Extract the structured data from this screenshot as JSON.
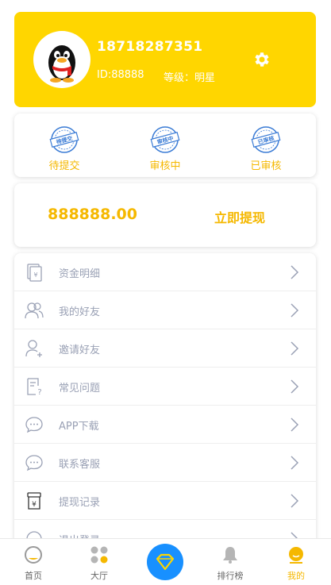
{
  "profile": {
    "phone": "18718287351",
    "id_text": "ID:88888",
    "level_text": "等级：明星",
    "avatar_icon": "qq-penguin-avatar",
    "settings_icon": "gear-icon"
  },
  "status": {
    "items": [
      {
        "label": "待提交",
        "stamp": "待提交"
      },
      {
        "label": "审核中",
        "stamp": "审核中"
      },
      {
        "label": "已审核",
        "stamp": "已审核"
      }
    ]
  },
  "wallet": {
    "balance": "888888.00",
    "withdraw_label": "立即提现"
  },
  "menu": {
    "items": [
      {
        "label": "资金明细",
        "icon": "ledger-icon"
      },
      {
        "label": "我的好友",
        "icon": "friends-icon"
      },
      {
        "label": "邀请好友",
        "icon": "invite-user-icon"
      },
      {
        "label": "常见问题",
        "icon": "faq-icon"
      },
      {
        "label": "APP下载",
        "icon": "chat-bubble-icon"
      },
      {
        "label": "联系客服",
        "icon": "chat-bubble-icon"
      },
      {
        "label": "提现记录",
        "icon": "withdraw-record-icon"
      },
      {
        "label": "退出登录",
        "icon": "logout-icon"
      }
    ]
  },
  "tabbar": {
    "items": [
      {
        "label": "首页",
        "icon": "home-icon"
      },
      {
        "label": "大厅",
        "icon": "hall-icon"
      },
      {
        "label": "排行榜",
        "icon": "bell-icon"
      },
      {
        "label": "我的",
        "icon": "profile-icon"
      }
    ],
    "center_icon": "diamond-icon"
  },
  "colors": {
    "brand_yellow": "#FFD600",
    "accent_text": "#F5B800",
    "stamp_blue": "#3A7BD5",
    "center_blue": "#1890FF"
  }
}
